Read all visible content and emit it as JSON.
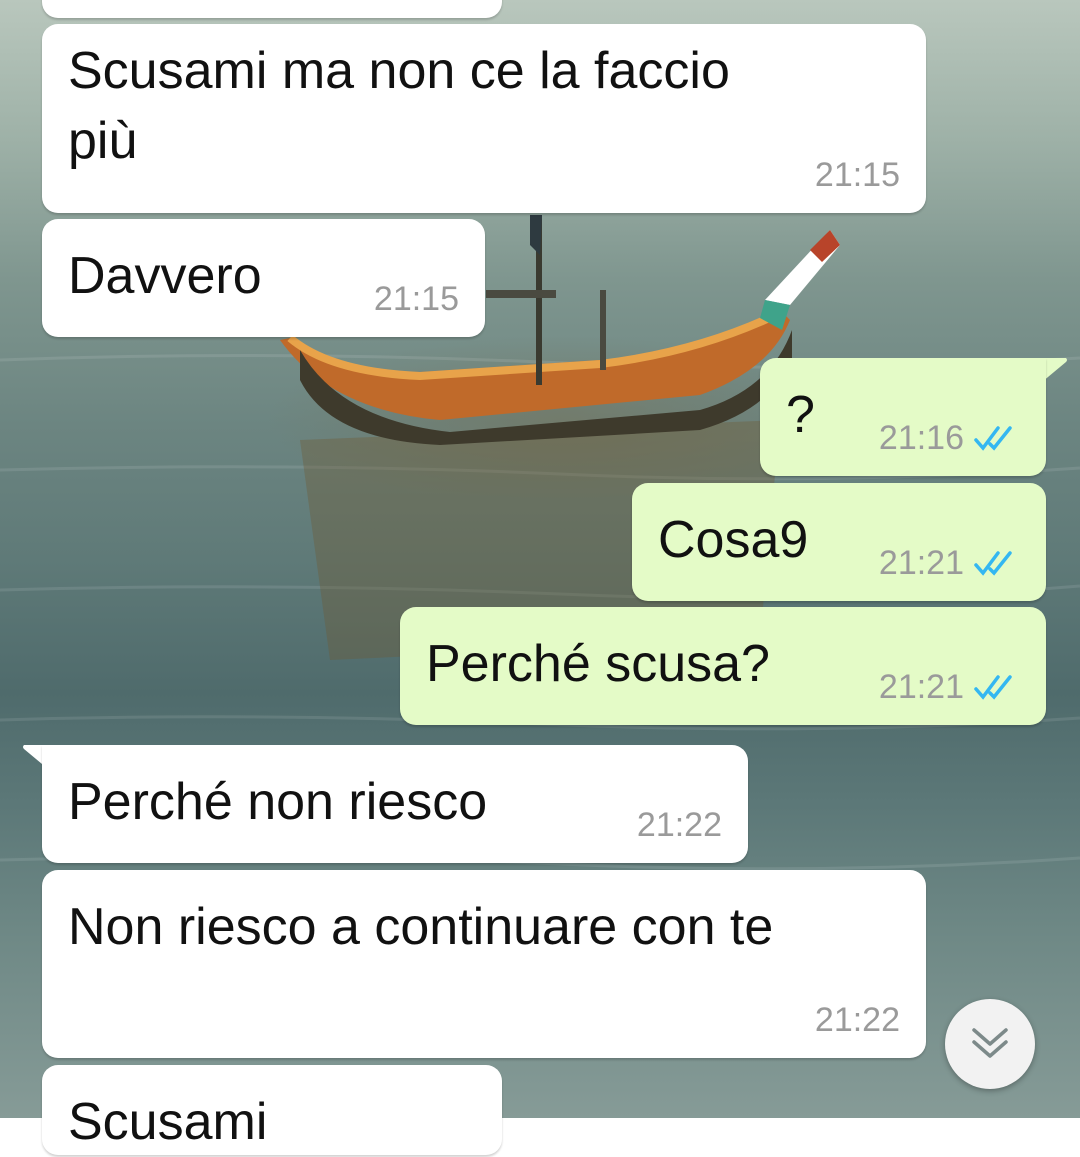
{
  "chat": {
    "messages": [
      {
        "direction": "in",
        "text": "",
        "time": ""
      },
      {
        "direction": "in",
        "text": "Scusami ma non ce la faccio\npiù",
        "time": "21:15"
      },
      {
        "direction": "in",
        "text": "Davvero",
        "time": "21:15"
      },
      {
        "direction": "out",
        "text": "?",
        "time": "21:16",
        "status": "read"
      },
      {
        "direction": "out",
        "text": "Cosa9",
        "time": "21:21",
        "status": "read"
      },
      {
        "direction": "out",
        "text": "Perché scusa?",
        "time": "21:21",
        "status": "read"
      },
      {
        "direction": "in",
        "text": "Perché non riesco",
        "time": "21:22"
      },
      {
        "direction": "in",
        "text": "Non riesco a continuare con te",
        "time": "21:22"
      },
      {
        "direction": "in",
        "text": "Scusami",
        "time": ""
      }
    ],
    "scroll_button_icon": "double-chevron-down-icon"
  },
  "colors": {
    "incoming_bubble": "#ffffff",
    "outgoing_bubble": "#e4fbc7",
    "read_ticks": "#34b7f1",
    "timestamp": "#9a9a9a"
  }
}
